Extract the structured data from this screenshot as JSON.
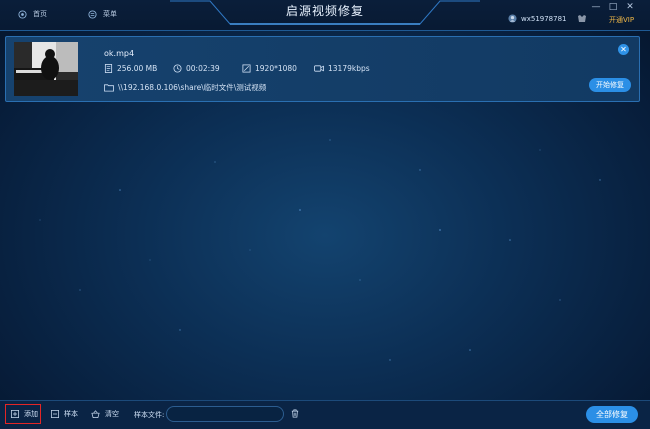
{
  "titlebar": {
    "home_label": "首页",
    "menu_label": "菜单",
    "app_title": "启源视频修复",
    "username": "wx51978781",
    "vip_label": "开通VIP",
    "minimize": "—",
    "maximize": "□",
    "close": "✕"
  },
  "file": {
    "name": "ok.mp4",
    "size": "256.00 MB",
    "duration": "00:02:39",
    "resolution": "1920*1080",
    "bitrate": "13179kbps",
    "path": "\\\\192.168.0.106\\share\\临时文件\\测试视频",
    "repair_label": "开始修复",
    "remove_label": "✕"
  },
  "bottombar": {
    "add_label": "添加",
    "sample_label": "样本",
    "clear_label": "清空",
    "sample_file_label": "样本文件:",
    "sample_file_value": "",
    "repair_all_label": "全部修复"
  },
  "colors": {
    "accent": "#2b8fe6",
    "vip": "#f0b847",
    "highlight_border": "#e32626"
  }
}
